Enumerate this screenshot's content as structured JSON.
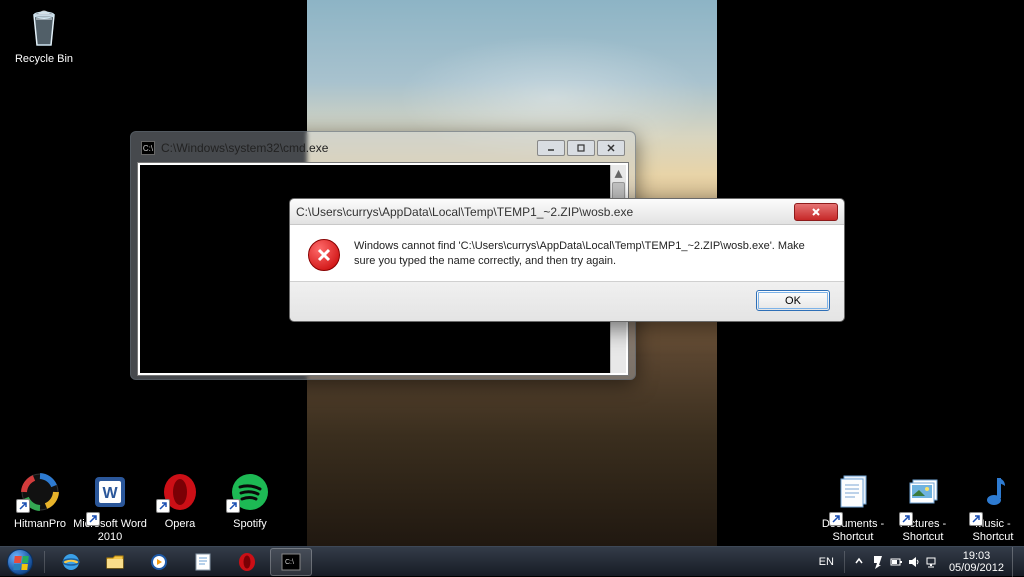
{
  "desktop": {
    "icons": {
      "recycle_bin": "Recycle Bin",
      "hitmanpro": "HitmanPro",
      "word": "Microsoft Word 2010",
      "opera": "Opera",
      "spotify": "Spotify",
      "documents": "Documents - Shortcut",
      "pictures": "Pictures - Shortcut",
      "music": "Music - Shortcut"
    }
  },
  "cmd": {
    "title": "C:\\Windows\\system32\\cmd.exe"
  },
  "dialog": {
    "title": "C:\\Users\\currys\\AppData\\Local\\Temp\\TEMP1_~2.ZIP\\wosb.exe",
    "message": "Windows cannot find 'C:\\Users\\currys\\AppData\\Local\\Temp\\TEMP1_~2.ZIP\\wosb.exe'. Make sure you typed the name correctly, and then try again.",
    "ok": "OK"
  },
  "taskbar": {
    "lang": "EN",
    "time": "19:03",
    "date": "05/09/2012"
  }
}
